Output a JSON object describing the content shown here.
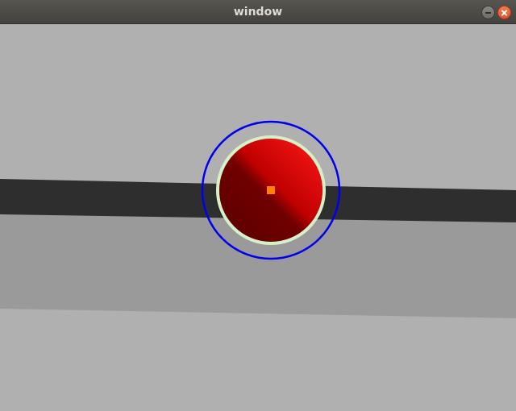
{
  "window": {
    "title": "window"
  },
  "icons": {
    "minimize": "minimize-icon",
    "close": "close-icon"
  },
  "colors": {
    "background": "#b0b0b0",
    "lower_floor": "#9a9a9a",
    "road": "#2e2e2e",
    "outer_ring": "#0000ee",
    "inner_ring": "#d8f0c8",
    "ball_highlight": "#ff0000",
    "ball_shadow": "#5a0000",
    "center_marker": "#ff8000"
  }
}
